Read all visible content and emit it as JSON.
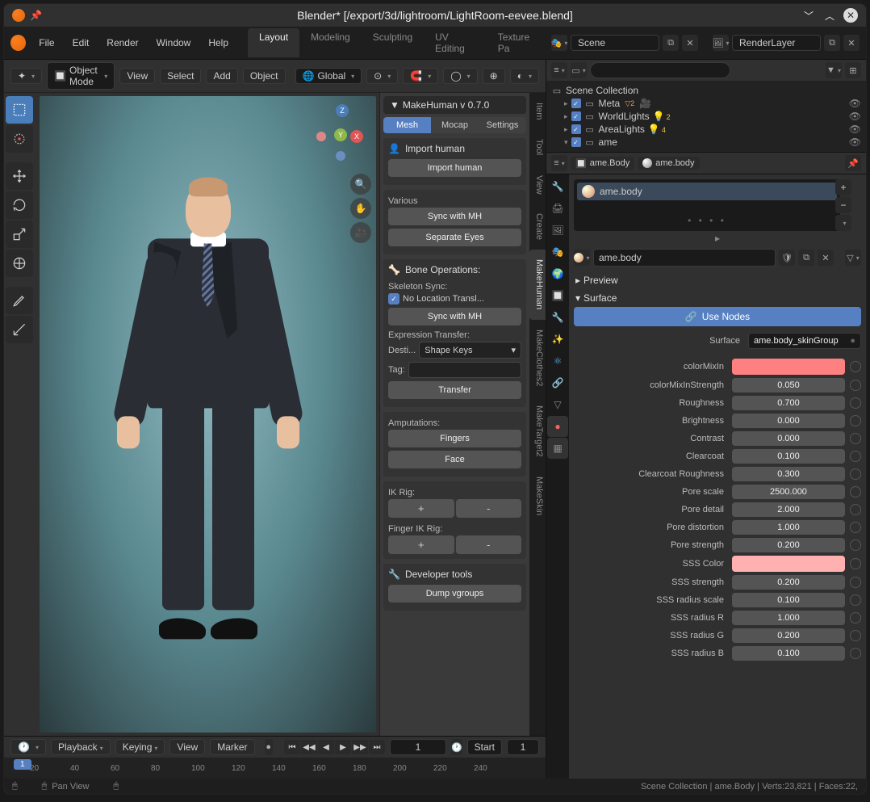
{
  "window": {
    "title": "Blender* [/export/3d/lightroom/LightRoom-eevee.blend]"
  },
  "menubar": {
    "items": [
      "File",
      "Edit",
      "Render",
      "Window",
      "Help"
    ]
  },
  "workspace_tabs": {
    "items": [
      "Layout",
      "Modeling",
      "Sculpting",
      "UV Editing",
      "Texture Pa"
    ],
    "active": "Layout"
  },
  "scene": {
    "name": "Scene"
  },
  "view_layer": {
    "name": "RenderLayer"
  },
  "viewport_header": {
    "mode": "Object Mode",
    "menus": [
      "View",
      "Select",
      "Add",
      "Object"
    ],
    "orientation": "Global"
  },
  "side_panel": {
    "title": "MakeHuman v 0.7.0",
    "tabs": [
      "Mesh",
      "Mocap",
      "Settings"
    ],
    "sections": {
      "import": {
        "title": "Import human",
        "button": "Import human"
      },
      "various": {
        "title": "Various",
        "sync": "Sync with MH",
        "separate": "Separate Eyes"
      },
      "bone": {
        "title": "Bone Operations:",
        "skeleton_sync": "Skeleton Sync:",
        "no_loc": "No Location Transl...",
        "sync": "Sync with MH",
        "expr_transfer": "Expression Transfer:",
        "dest_label": "Desti...",
        "dest_value": "Shape Keys",
        "tag_label": "Tag:",
        "transfer_btn": "Transfer"
      },
      "amputations": {
        "title": "Amputations:",
        "fingers": "Fingers",
        "face": "Face"
      },
      "ikrig": {
        "title": "IK Rig:",
        "finger_title": "Finger IK Rig:"
      },
      "dev": {
        "title": "Developer tools",
        "dump": "Dump vgroups"
      }
    },
    "vertical_tabs": [
      "Item",
      "Tool",
      "View",
      "Create",
      "MakeHuman",
      "MakeClothes2",
      "MakeTarget2",
      "MakeSkin"
    ]
  },
  "timeline": {
    "menus": [
      "Playback",
      "Keying",
      "View",
      "Marker"
    ],
    "frame": "1",
    "start_label": "Start",
    "start": "1",
    "ticks": [
      "20",
      "40",
      "60",
      "80",
      "100",
      "120",
      "140",
      "160",
      "180",
      "200",
      "220",
      "240"
    ],
    "current": "1"
  },
  "outliner": {
    "root": "Scene Collection",
    "items": [
      {
        "name": "Meta",
        "badge": "2",
        "badge_color": "orange"
      },
      {
        "name": "WorldLights",
        "badge": "2",
        "badge_color": "yellow"
      },
      {
        "name": "AreaLights",
        "badge": "4",
        "badge_color": "yellow"
      },
      {
        "name": "ame",
        "expanded": true
      }
    ]
  },
  "properties": {
    "breadcrumb": {
      "obj": "ame.Body",
      "mat": "ame.body"
    },
    "material_slot": "ame.body",
    "material_name": "ame.body",
    "panels": {
      "preview": "Preview",
      "surface": "Surface"
    },
    "use_nodes": "Use Nodes",
    "surface_shader": {
      "label": "Surface",
      "value": "ame.body_skinGroup"
    },
    "params": [
      {
        "label": "colorMixIn",
        "type": "color",
        "color": "#ff8080"
      },
      {
        "label": "colorMixInStrength",
        "type": "num",
        "value": "0.050"
      },
      {
        "label": "Roughness",
        "type": "num",
        "value": "0.700"
      },
      {
        "label": "Brightness",
        "type": "num",
        "value": "0.000"
      },
      {
        "label": "Contrast",
        "type": "num",
        "value": "0.000"
      },
      {
        "label": "Clearcoat",
        "type": "num",
        "value": "0.100"
      },
      {
        "label": "Clearcoat Roughness",
        "type": "num",
        "value": "0.300"
      },
      {
        "label": "Pore scale",
        "type": "num",
        "value": "2500.000"
      },
      {
        "label": "Pore detail",
        "type": "num",
        "value": "2.000"
      },
      {
        "label": "Pore distortion",
        "type": "num",
        "value": "1.000"
      },
      {
        "label": "Pore strength",
        "type": "num",
        "value": "0.200"
      },
      {
        "label": "SSS Color",
        "type": "color",
        "color": "#ffb0b0"
      },
      {
        "label": "SSS strength",
        "type": "num",
        "value": "0.200"
      },
      {
        "label": "SSS radius scale",
        "type": "num",
        "value": "0.100"
      },
      {
        "label": "SSS radius R",
        "type": "num",
        "value": "1.000"
      },
      {
        "label": "SSS radius G",
        "type": "num",
        "value": "0.200"
      },
      {
        "label": "SSS radius B",
        "type": "num",
        "value": "0.100"
      }
    ]
  },
  "statusbar": {
    "hint": "Pan View",
    "info": "Scene Collection | ame.Body | Verts:23,821 | Faces:22,"
  }
}
